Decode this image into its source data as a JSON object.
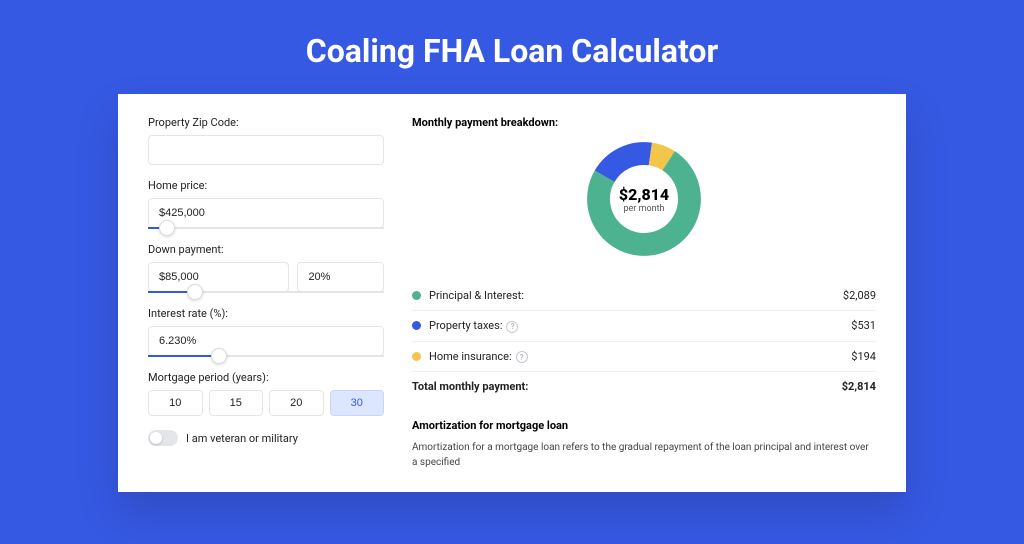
{
  "page": {
    "title": "Coaling FHA Loan Calculator"
  },
  "form": {
    "zip": {
      "label": "Property Zip Code:",
      "value": ""
    },
    "price": {
      "label": "Home price:",
      "value": "$425,000",
      "slider_pct": 8
    },
    "down": {
      "label": "Down payment:",
      "amount": "$85,000",
      "percent": "20%",
      "slider_pct": 20
    },
    "rate": {
      "label": "Interest rate (%):",
      "value": "6.230%",
      "slider_pct": 30
    },
    "period": {
      "label": "Mortgage period (years):",
      "options": [
        "10",
        "15",
        "20",
        "30"
      ],
      "selected": "30"
    },
    "veteran_label": "I am veteran or military"
  },
  "breakdown": {
    "title": "Monthly payment breakdown:",
    "center_amount": "$2,814",
    "center_sub": "per month",
    "rows": [
      {
        "label": "Principal & Interest:",
        "value": "$2,089",
        "color": "#4cb28f"
      },
      {
        "label": "Property taxes:",
        "value": "$531",
        "color": "#3659e3",
        "help": true
      },
      {
        "label": "Home insurance:",
        "value": "$194",
        "color": "#f3c64b",
        "help": true
      }
    ],
    "total": {
      "label": "Total monthly payment:",
      "value": "$2,814"
    }
  },
  "amort": {
    "title": "Amortization for mortgage loan",
    "text": "Amortization for a mortgage loan refers to the gradual repayment of the loan principal and interest over a specified"
  },
  "chart_data": {
    "type": "pie",
    "title": "Monthly payment breakdown",
    "series": [
      {
        "name": "Principal & Interest",
        "value": 2089,
        "color": "#4cb28f"
      },
      {
        "name": "Property taxes",
        "value": 531,
        "color": "#3659e3"
      },
      {
        "name": "Home insurance",
        "value": 194,
        "color": "#f3c64b"
      }
    ],
    "total": 2814,
    "unit": "USD/month"
  }
}
